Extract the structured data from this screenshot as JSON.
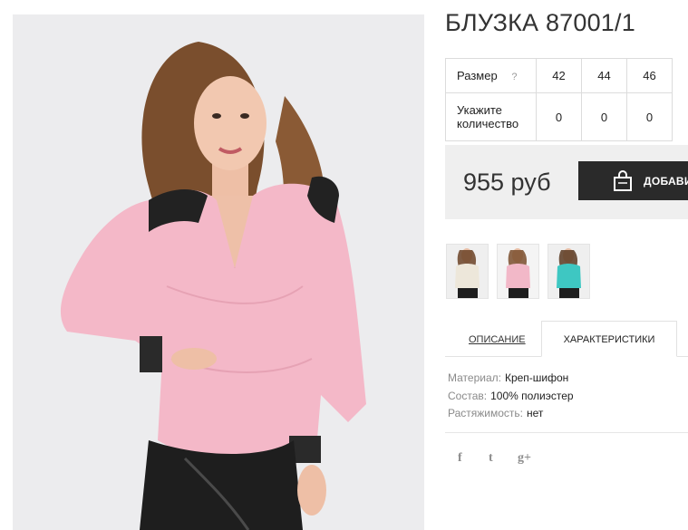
{
  "product": {
    "title": "БЛУЗКА 87001/1",
    "price": "955 руб",
    "add_to_cart_label": "ДОБАВИТЬ"
  },
  "size_table": {
    "size_label": "Размер",
    "help_icon": "?",
    "sizes": [
      "42",
      "44",
      "46"
    ],
    "quantity_label": "Укажите количество",
    "quantities": [
      "0",
      "0",
      "0"
    ]
  },
  "thumbnails": [
    {
      "name": "thumb-cream-blouse",
      "color": "#ede7da"
    },
    {
      "name": "thumb-pink-blouse",
      "color": "#f2b8c8"
    },
    {
      "name": "thumb-turquoise-blouse",
      "color": "#3ec7c2"
    }
  ],
  "tabs": {
    "description": "ОПИСАНИЕ",
    "characteristics": "ХАРАКТЕРИСТИКИ"
  },
  "specs": [
    {
      "key": "Материал:",
      "value": "Креп-шифон"
    },
    {
      "key": "Состав:",
      "value": "100% полиэстер"
    },
    {
      "key": "Растяжимость:",
      "value": "нет"
    }
  ],
  "social": [
    {
      "name": "facebook-icon",
      "glyph": "f"
    },
    {
      "name": "twitter-icon",
      "glyph": "t"
    },
    {
      "name": "google-plus-icon",
      "glyph": "g+"
    }
  ],
  "colors": {
    "blouse_pink": "#f4b8c8",
    "skirt": "#1e1e1e",
    "button": "#2a2a2a",
    "price_box": "#efefef"
  }
}
